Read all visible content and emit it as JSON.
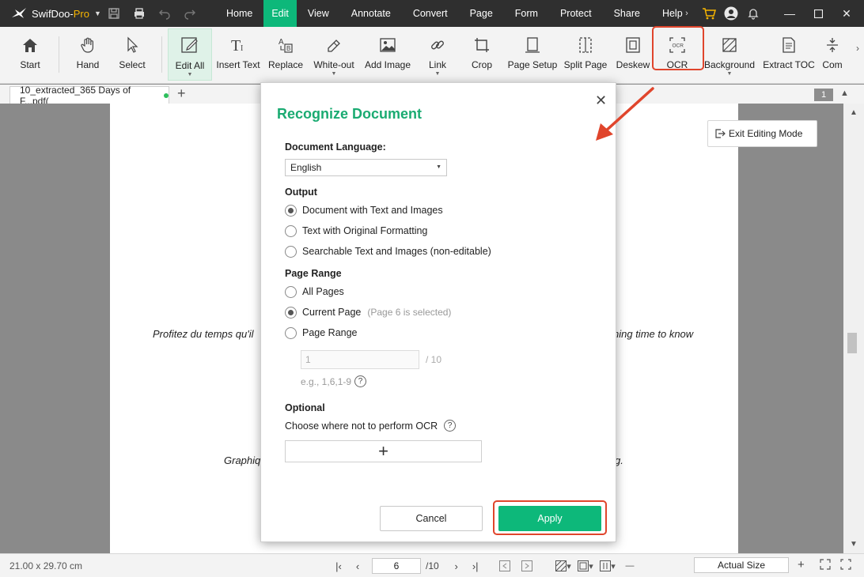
{
  "app": {
    "name_main": "SwifDoo-",
    "name_pro": "Pro"
  },
  "menu": [
    "Home",
    "Edit",
    "View",
    "Annotate",
    "Convert",
    "Page",
    "Form",
    "Protect",
    "Share",
    "Help"
  ],
  "menu_active": "Edit",
  "ribbon": {
    "start": "Start",
    "hand": "Hand",
    "select": "Select",
    "edit_all": "Edit All",
    "insert_text": "Insert Text",
    "replace": "Replace",
    "white_out": "White-out",
    "add_image": "Add Image",
    "link": "Link",
    "crop": "Crop",
    "page_setup": "Page Setup",
    "split_page": "Split Page",
    "deskew": "Deskew",
    "ocr": "OCR",
    "background": "Background",
    "extract_toc": "Extract TOC",
    "compress": "Com"
  },
  "tabs": {
    "document": "10_extracted_365 Days of F...pdf(",
    "page_badge": "1"
  },
  "document": {
    "line1_left": "Profitez du temps qu'il",
    "line1_right": "ning time to know",
    "line2_left": "Graphiq",
    "line2_right": "g."
  },
  "exit_editing": "Exit Editing Mode",
  "dialog": {
    "title": "Recognize Document",
    "language_label": "Document Language:",
    "language_value": "English",
    "output_label": "Output",
    "output_options": [
      "Document with Text and Images",
      "Text with Original Formatting",
      "Searchable Text and Images (non-editable)"
    ],
    "page_range_label": "Page Range",
    "range_all": "All Pages",
    "range_current": "Current Page",
    "range_current_hint": "(Page 6 is selected)",
    "range_custom": "Page Range",
    "range_input": "1",
    "range_total": "/ 10",
    "range_example": "e.g., 1,6,1-9",
    "optional_label": "Optional",
    "optional_desc": "Choose where not to perform OCR",
    "cancel": "Cancel",
    "apply": "Apply"
  },
  "status": {
    "dimensions": "21.00 x 29.70 cm",
    "current_page": "6",
    "total_pages": "/10",
    "zoom": "Actual Size"
  },
  "colors": {
    "accent": "#0db87a",
    "annotation": "#e0452c",
    "titlebar": "#2f2f2f"
  }
}
